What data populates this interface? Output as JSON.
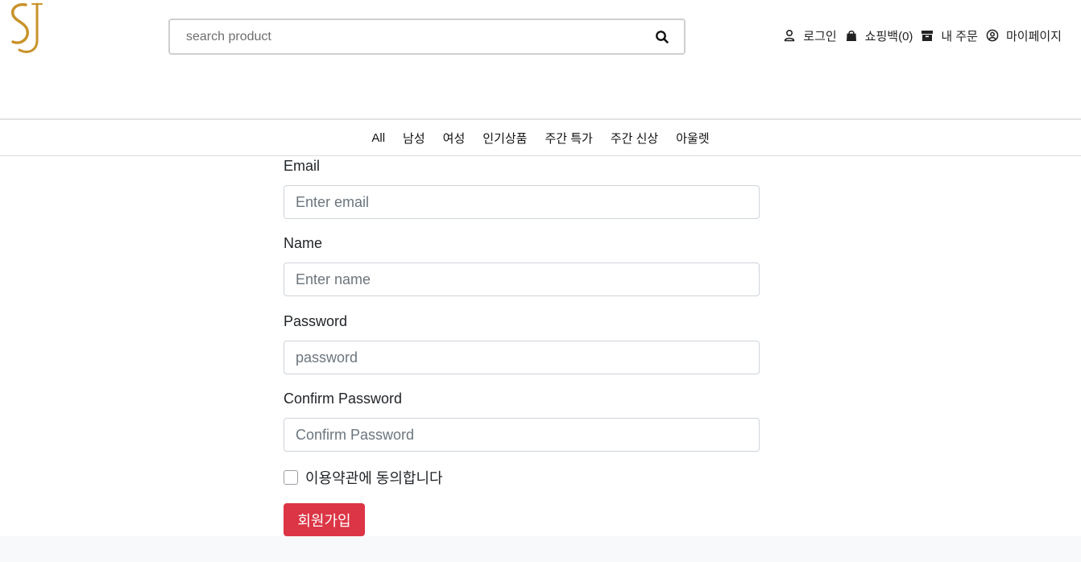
{
  "header": {
    "logo_text": "SJ",
    "search": {
      "placeholder": "search product",
      "value": ""
    },
    "links": [
      {
        "label": "로그인",
        "icon": "user-icon"
      },
      {
        "label": "쇼핑백(0)",
        "icon": "shopping-bag-icon"
      },
      {
        "label": "내 주문",
        "icon": "box-icon"
      },
      {
        "label": "마이페이지",
        "icon": "user-circle-icon"
      }
    ]
  },
  "nav": {
    "items": [
      "All",
      "남성",
      "여성",
      "인기상품",
      "주간 특가",
      "주간 신상",
      "아울렛"
    ]
  },
  "form": {
    "email": {
      "label": "Email",
      "placeholder": "Enter email",
      "value": ""
    },
    "name": {
      "label": "Name",
      "placeholder": "Enter name",
      "value": ""
    },
    "password": {
      "label": "Password",
      "placeholder": "password",
      "value": ""
    },
    "confirm_password": {
      "label": "Confirm Password",
      "placeholder": "Confirm Password",
      "value": ""
    },
    "agree_label": "이용약관에 동의합니다",
    "agree_checked": false,
    "submit_label": "회원가입"
  },
  "colors": {
    "logo": "#c9922b",
    "submit": "#dc3545",
    "footer_band": "#f8f9fa"
  }
}
